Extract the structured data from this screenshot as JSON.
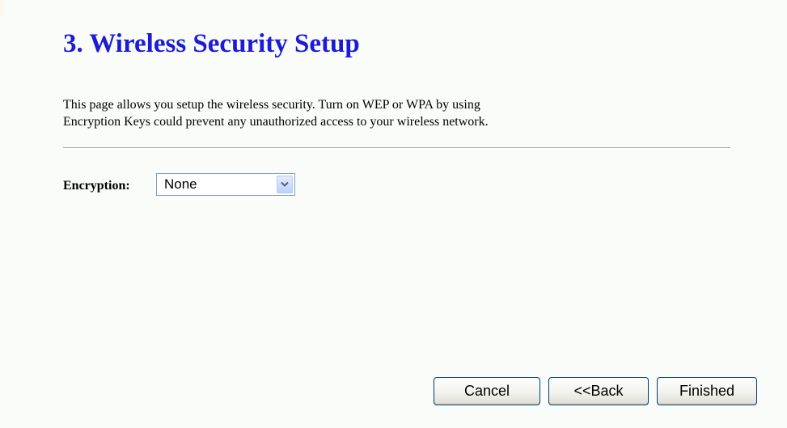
{
  "header": {
    "title": "3. Wireless Security Setup"
  },
  "description": {
    "line1": "This page allows you setup the wireless security. Turn on WEP or WPA by using",
    "line2": "Encryption Keys could prevent any unauthorized access to your wireless network."
  },
  "encryption": {
    "label": "Encryption:",
    "selected": "None",
    "arrow_icon": "chevron-down-icon"
  },
  "buttons": {
    "cancel": "Cancel",
    "back": "<<Back",
    "finished": "Finished"
  },
  "colors": {
    "title": "#1b1bd8",
    "background": "#f9fcf9",
    "button_border": "#003c74",
    "select_border": "#7f9db9"
  }
}
